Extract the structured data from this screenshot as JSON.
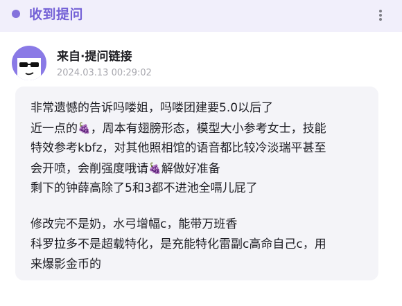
{
  "header": {
    "title": "收到提问",
    "menu_icon": "more-dots-icon"
  },
  "message": {
    "sender": "来自·提问链接",
    "timestamp": "2024.03.13 00:29:02",
    "avatar_icon": "sunglasses-avatar-icon",
    "emoji": "🍇",
    "lines": {
      "l1": "非常遗憾的告诉吗喽姐，吗喽团建要5.0以后了",
      "l2a": "近一点的",
      "l2b": "，周本有翅膀形态，模型大小参考女士，技能",
      "l3": "特效参考kbfz，对其他照相馆的语音都比较冷淡瑞平甚至",
      "l4a": "会开喷，会削强度哦请",
      "l4b": "解做好准备",
      "l5": "剩下的钟薛高除了5和3都不进池全嗝儿屁了",
      "l6": "修改完不是奶，水弓增幅c，能带万班香",
      "l7": "科罗拉多不是超载特化，是充能特化雷副c高命自己c，用",
      "l8": "来爆影金币的"
    }
  }
}
